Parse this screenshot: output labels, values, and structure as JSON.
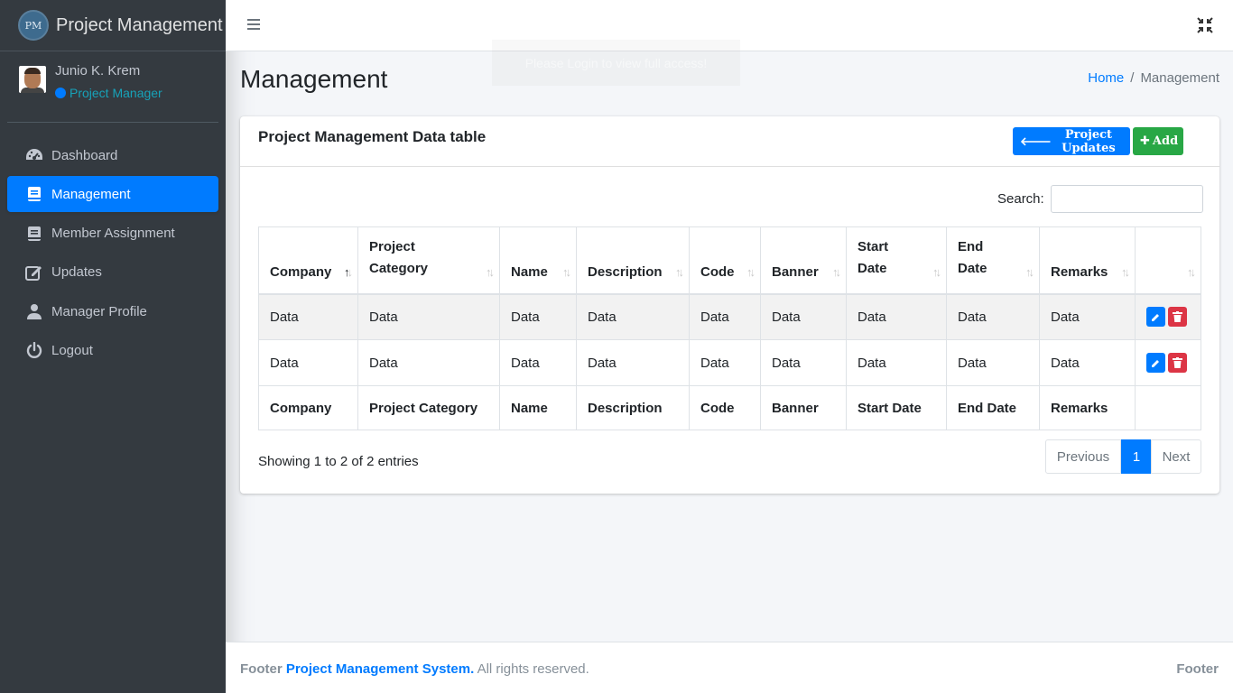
{
  "brand": {
    "name": "Project Management",
    "logo_text": "PM"
  },
  "user": {
    "name": "Junio K. Krem",
    "role": "Project Manager"
  },
  "nav": [
    {
      "label": "Dashboard",
      "icon": "tachometer-icon"
    },
    {
      "label": "Management",
      "icon": "book-icon",
      "active": true
    },
    {
      "label": "Member Assignment",
      "icon": "book-icon"
    },
    {
      "label": "Updates",
      "icon": "edit-icon"
    },
    {
      "label": "Manager Profile",
      "icon": "user-icon"
    },
    {
      "label": "Logout",
      "icon": "power-icon"
    }
  ],
  "toast": {
    "text": "Please Login to view full access!"
  },
  "page": {
    "title": "Management"
  },
  "breadcrumb": {
    "home": "Home",
    "current": "Management",
    "separator": "/"
  },
  "card": {
    "title": "Project Management Data table",
    "btn_updates": "Project Updates",
    "btn_add": "Add",
    "search_label": "Search:"
  },
  "table": {
    "headers": [
      "Company",
      "Project Category",
      "Name",
      "Description",
      "Code",
      "Banner",
      "Start Date",
      "End Date",
      "Remarks"
    ],
    "rows": [
      [
        "Data",
        "Data",
        "Data",
        "Data",
        "Data",
        "Data",
        "Data",
        "Data",
        "Data"
      ],
      [
        "Data",
        "Data",
        "Data",
        "Data",
        "Data",
        "Data",
        "Data",
        "Data",
        "Data"
      ]
    ],
    "footers": [
      "Company",
      "Project Category",
      "Name",
      "Description",
      "Code",
      "Banner",
      "Start Date",
      "End Date",
      "Remarks"
    ]
  },
  "info": "Showing 1 to 2 of 2 entries",
  "pagination": {
    "previous": "Previous",
    "page": "1",
    "next": "Next"
  },
  "footer": {
    "prefix": "Footer",
    "link": "Project Management System.",
    "suffix": "All rights reserved.",
    "right": "Footer"
  },
  "colors": {
    "primary": "#007bff",
    "success": "#28a745",
    "danger": "#dc3545",
    "sidebar": "#343a40"
  }
}
